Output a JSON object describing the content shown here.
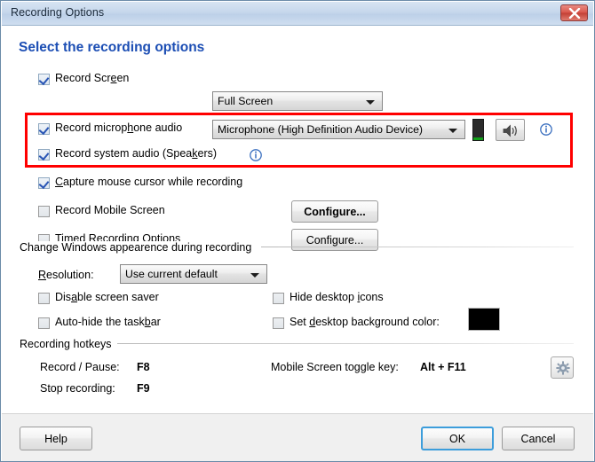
{
  "window": {
    "title": "Recording Options",
    "close_icon": "close-icon",
    "accent_color": "#1c4eb4",
    "highlight_color": "#ff0000"
  },
  "heading": "Select the recording options",
  "options": {
    "record_screen": {
      "label_pre": "Record Scr",
      "label_accel": "e",
      "label_post": "en",
      "checked": true,
      "combo_value": "Full Screen"
    },
    "record_microphone": {
      "label_pre": "Record microp",
      "label_accel": "h",
      "label_post": "one audio",
      "checked": true,
      "combo_value": "Microphone (High Definition Audio Device)",
      "vu_meter_level": "12%",
      "vu_meter_color": "#11a11a",
      "speaker_icon": "speaker-icon",
      "info_icon": "info-icon"
    },
    "record_system_audio": {
      "label_pre": "Record system audio (Spea",
      "label_accel": "k",
      "label_post": "ers)",
      "checked": true,
      "info_icon": "info-icon"
    },
    "capture_cursor": {
      "label_pre": "",
      "label_accel": "C",
      "label_post": "apture mouse cursor while recording",
      "checked": true
    },
    "record_mobile": {
      "label_pre": "Record Mobile Screen",
      "label_accel": "",
      "label_post": "",
      "checked": false,
      "button_label": "Configure..."
    },
    "timed_recording": {
      "label_pre": "",
      "label_accel": "T",
      "label_post": "imed Recording Options",
      "checked": false,
      "button_label": "Configure..."
    }
  },
  "appearance": {
    "group_label": "Change Windows appearence during recording",
    "resolution": {
      "label_accel": "R",
      "label_post": "esolution:",
      "combo_value": "Use current default"
    },
    "disable_screen_saver": {
      "label_pre": "Dis",
      "label_accel": "a",
      "label_post": "ble screen saver",
      "checked": false
    },
    "auto_hide_taskbar": {
      "label_pre": "Auto-hide the task",
      "label_accel": "b",
      "label_post": "ar",
      "checked": false
    },
    "hide_desktop_icons": {
      "label_pre": "Hide desktop ",
      "label_accel": "i",
      "label_post": "cons",
      "checked": false
    },
    "set_desktop_bg": {
      "label_pre": "Set ",
      "label_accel": "d",
      "label_post": "esktop background color:",
      "checked": false,
      "swatch_color": "#000000"
    }
  },
  "hotkeys": {
    "group_label": "Recording hotkeys",
    "record_pause_label": "Record / Pause:",
    "record_pause_key": "F8",
    "stop_recording_label": "Stop recording:",
    "stop_recording_key": "F9",
    "mobile_toggle_label": "Mobile Screen toggle key:",
    "mobile_toggle_key": "Alt + F11",
    "gear_icon": "gear-icon"
  },
  "footer": {
    "help_label": "Help",
    "ok_label": "OK",
    "cancel_label": "Cancel"
  }
}
